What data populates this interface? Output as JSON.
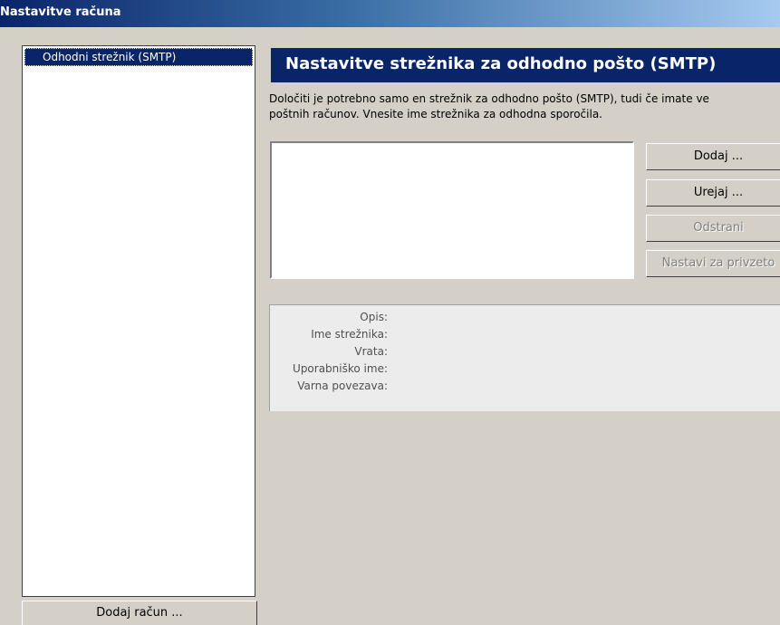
{
  "window": {
    "title": "Nastavitve računa"
  },
  "sidebar": {
    "items": [
      {
        "label": "Odhodni strežnik (SMTP)",
        "selected": true
      }
    ],
    "add_account_label": "Dodaj račun ..."
  },
  "panel": {
    "title": "Nastavitve strežnika za odhodno pošto (SMTP)",
    "description_line1": "Določiti je potrebno samo en strežnik za odhodno pošto (SMTP), tudi če imate ve",
    "description_line2": "poštnih računov. Vnesite ime strežnika za odhodna sporočila."
  },
  "buttons": {
    "add": "Dodaj ...",
    "edit": "Urejaj ...",
    "remove": "Odstrani",
    "set_default": "Nastavi za privzeto"
  },
  "details": {
    "labels": [
      "Opis:",
      "Ime strežnika:",
      "Vrata:",
      "Uporabniško ime:",
      "Varna povezava:"
    ]
  },
  "colors": {
    "selection": "#0a246a",
    "window_bg": "#d4d0c8",
    "disabled_text": "#808080"
  }
}
